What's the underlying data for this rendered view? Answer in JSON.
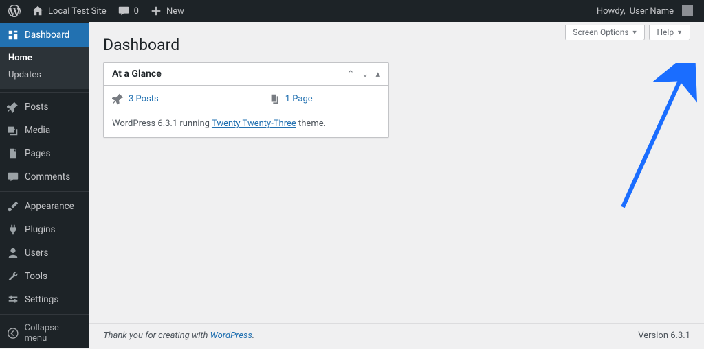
{
  "adminbar": {
    "site_name": "Local Test Site",
    "comments_count": "0",
    "new_label": "New",
    "howdy_prefix": "Howdy, ",
    "user_name": "User Name"
  },
  "sidebar": {
    "dashboard": "Dashboard",
    "submenu": {
      "home": "Home",
      "updates": "Updates"
    },
    "posts": "Posts",
    "media": "Media",
    "pages": "Pages",
    "comments": "Comments",
    "appearance": "Appearance",
    "plugins": "Plugins",
    "users": "Users",
    "tools": "Tools",
    "settings": "Settings",
    "collapse": "Collapse menu"
  },
  "content": {
    "screen_options": "Screen Options",
    "help": "Help",
    "page_title": "Dashboard",
    "glance": {
      "title": "At a Glance",
      "posts": "3 Posts",
      "pages": "1 Page",
      "wp_prefix": "WordPress 6.3.1 running ",
      "theme": "Twenty Twenty-Three",
      "wp_suffix": " theme."
    }
  },
  "footer": {
    "thanks_prefix": "Thank you for creating with ",
    "wp_link": "WordPress",
    "thanks_suffix": ".",
    "version": "Version 6.3.1"
  },
  "colors": {
    "accent": "#2271b1",
    "arrow": "#1a6dff"
  }
}
